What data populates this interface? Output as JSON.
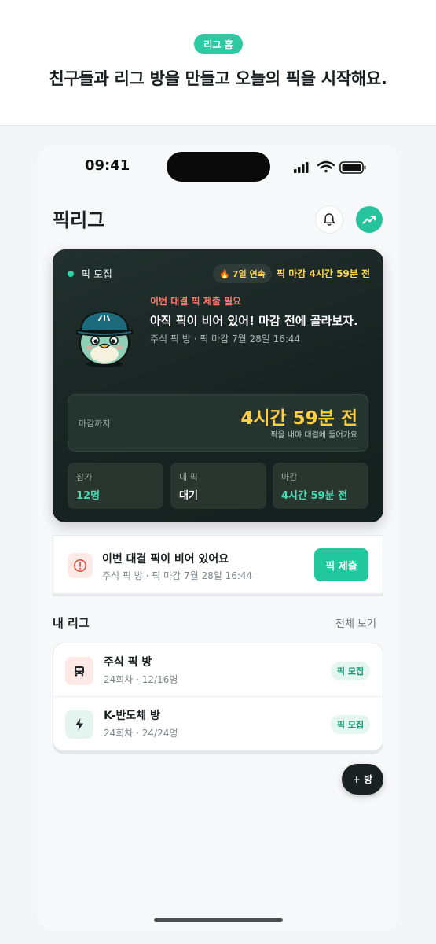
{
  "banner": {
    "pill": "리그 홈",
    "headline": "친구들과 리그 방을 만들고 오늘의 픽을 시작해요."
  },
  "status_bar": {
    "time": "09:41",
    "icons": [
      "signal-icon",
      "wifi-icon",
      "battery-icon"
    ]
  },
  "header": {
    "title": "픽리그",
    "icons": [
      "bell-icon",
      "trending-up-icon"
    ]
  },
  "hero": {
    "status": "픽 모집",
    "streak": "7일 연속",
    "deadline_top": "픽 마감 4시간 59분 전",
    "need_label": "이번 대결 픽 제출 필요",
    "message": "아직 픽이 비어 있어! 마감 전에 골라보자.",
    "sub": "주식 픽 방 · 픽 마감 7월 28일 16:44",
    "deadline_label": "마감까지",
    "deadline_value": "4시간 59분 전",
    "deadline_hint": "픽을 내야 대결에 들어가요",
    "stats": [
      {
        "label": "참가",
        "value": "12명",
        "color": "#3fe0b4"
      },
      {
        "label": "내 픽",
        "value": "대기",
        "color": "#ffffff"
      },
      {
        "label": "마감",
        "value": "4시간 59분 전",
        "color": "#3fe0b4"
      }
    ]
  },
  "alert": {
    "title": "이번 대결 픽이 비어 있어요",
    "sub": "주식 픽 방 · 픽 마감 7월 28일 16:44",
    "button": "픽 제출"
  },
  "my_leagues": {
    "title": "내 리그",
    "see_all": "전체 보기",
    "items": [
      {
        "name": "주식 픽 방",
        "meta": "24회차 · 12/16명",
        "badge": "픽 모집",
        "icon": "bus-icon",
        "icon_bg": "#fde9e6"
      },
      {
        "name": "K-반도체 방",
        "meta": "24회차 · 24/24명",
        "badge": "픽 모집",
        "icon": "lightning-icon",
        "icon_bg": "#e4f5ef"
      }
    ]
  },
  "fab": {
    "label": "+ 방"
  },
  "colors": {
    "accent": "#26c49c",
    "hero_bg": "#172320",
    "deadline_yellow": "#ffcf3f",
    "alert_red": "#ff7a6a"
  }
}
